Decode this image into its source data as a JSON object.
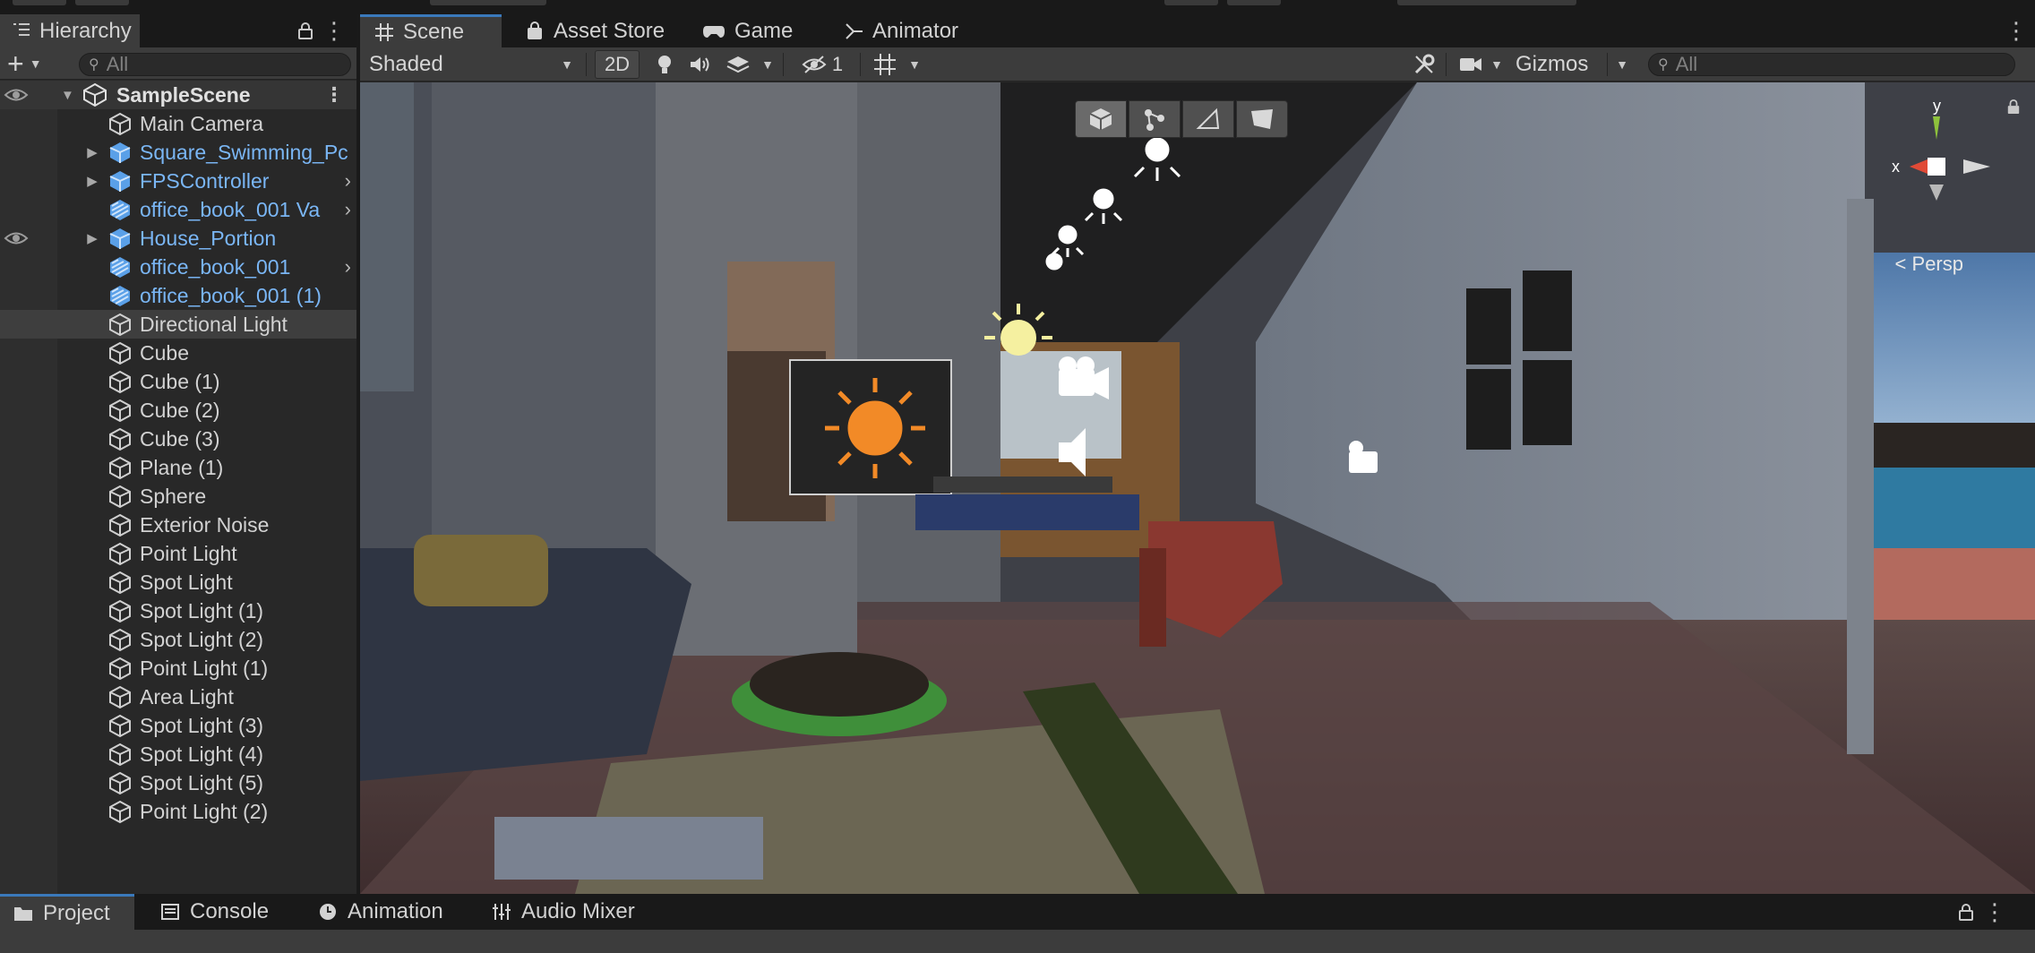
{
  "hierarchy": {
    "tab_label": "Hierarchy",
    "add_label": "+",
    "search_placeholder": "All",
    "scene_name": "SampleScene",
    "items": [
      {
        "label": "Main Camera",
        "type": "object"
      },
      {
        "label": "Square_Swimming_Pc",
        "type": "prefab",
        "expandable": true
      },
      {
        "label": "FPSController",
        "type": "prefab",
        "expandable": true,
        "chevron": true
      },
      {
        "label": "office_book_001 Va",
        "type": "prefab-variant",
        "chevron": true
      },
      {
        "label": "House_Portion",
        "type": "prefab",
        "expandable": true
      },
      {
        "label": "office_book_001",
        "type": "prefab-variant",
        "chevron": true
      },
      {
        "label": "office_book_001 (1)",
        "type": "prefab-variant"
      },
      {
        "label": "Directional Light",
        "type": "object",
        "selected": true
      },
      {
        "label": "Cube",
        "type": "object"
      },
      {
        "label": "Cube (1)",
        "type": "object"
      },
      {
        "label": "Cube (2)",
        "type": "object"
      },
      {
        "label": "Cube (3)",
        "type": "object"
      },
      {
        "label": "Plane (1)",
        "type": "object"
      },
      {
        "label": "Sphere",
        "type": "object"
      },
      {
        "label": "Exterior Noise",
        "type": "object"
      },
      {
        "label": "Point Light",
        "type": "object"
      },
      {
        "label": "Spot Light",
        "type": "object"
      },
      {
        "label": "Spot Light (1)",
        "type": "object"
      },
      {
        "label": "Spot Light (2)",
        "type": "object"
      },
      {
        "label": "Point Light (1)",
        "type": "object"
      },
      {
        "label": "Area Light",
        "type": "object"
      },
      {
        "label": "Spot Light (3)",
        "type": "object"
      },
      {
        "label": "Spot Light (4)",
        "type": "object"
      },
      {
        "label": "Spot Light (5)",
        "type": "object"
      },
      {
        "label": "Point Light (2)",
        "type": "object"
      }
    ]
  },
  "scene_view": {
    "tabs": [
      {
        "label": "Scene",
        "icon": "grid-icon",
        "active": true
      },
      {
        "label": "Asset Store",
        "icon": "shopping-bag-icon"
      },
      {
        "label": "Game",
        "icon": "gamepad-icon"
      },
      {
        "label": "Animator",
        "icon": "animator-icon"
      }
    ],
    "draw_mode": "Shaded",
    "mode_2d": "2D",
    "hidden_count": "1",
    "gizmos_label": "Gizmos",
    "search_placeholder": "All",
    "projection": "Persp",
    "axis_x": "x",
    "axis_y": "y"
  },
  "bottom_panel": {
    "tabs": [
      {
        "label": "Project",
        "icon": "folder-icon",
        "active": true
      },
      {
        "label": "Console",
        "icon": "console-icon"
      },
      {
        "label": "Animation",
        "icon": "clock-icon"
      },
      {
        "label": "Audio Mixer",
        "icon": "sliders-icon"
      }
    ]
  },
  "colors": {
    "accent": "#3a79bb",
    "prefab_text": "#7ab6f5",
    "panel_bg": "#282828",
    "toolbar_bg": "#3c3c3c"
  }
}
